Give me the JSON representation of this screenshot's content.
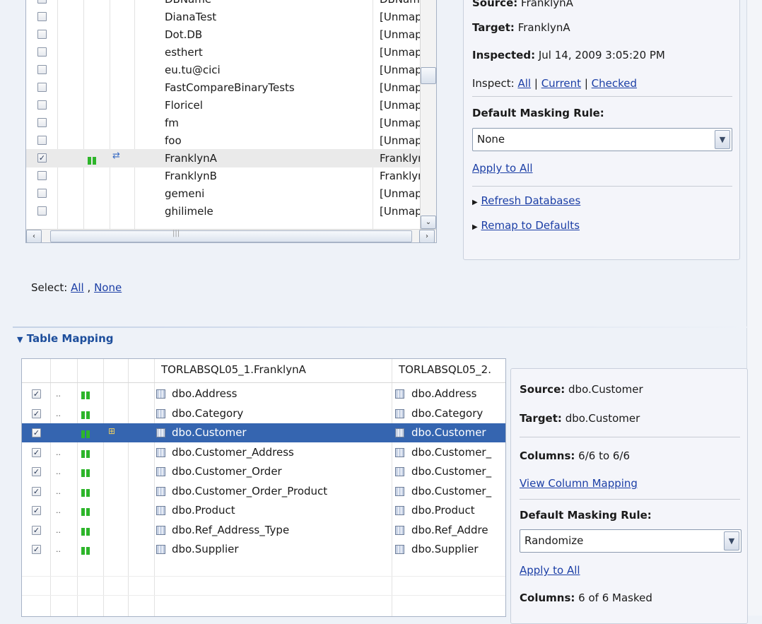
{
  "db_table": {
    "rows": [
      {
        "checked": false,
        "name": "DBName",
        "target": "DBName",
        "selected": false,
        "indicator": false
      },
      {
        "checked": false,
        "name": "DianaTest",
        "target": "[Unmappe",
        "selected": false,
        "indicator": false
      },
      {
        "checked": false,
        "name": "Dot.DB",
        "target": "[Unmappe",
        "selected": false,
        "indicator": false
      },
      {
        "checked": false,
        "name": "esthert",
        "target": "[Unmappe",
        "selected": false,
        "indicator": false
      },
      {
        "checked": false,
        "name": "eu.tu@cici",
        "target": "[Unmappe",
        "selected": false,
        "indicator": false
      },
      {
        "checked": false,
        "name": "FastCompareBinaryTests",
        "target": "[Unmappe",
        "selected": false,
        "indicator": false
      },
      {
        "checked": false,
        "name": "Floricel",
        "target": "[Unmappe",
        "selected": false,
        "indicator": false
      },
      {
        "checked": false,
        "name": "fm",
        "target": "[Unmappe",
        "selected": false,
        "indicator": false
      },
      {
        "checked": false,
        "name": "foo",
        "target": "[Unmappe",
        "selected": false,
        "indicator": false
      },
      {
        "checked": true,
        "name": "FranklynA",
        "target": "FranklynA",
        "selected": true,
        "indicator": true
      },
      {
        "checked": false,
        "name": "FranklynB",
        "target": "FranklynB",
        "selected": false,
        "indicator": false
      },
      {
        "checked": false,
        "name": "gemeni",
        "target": "[Unmappe",
        "selected": false,
        "indicator": false
      },
      {
        "checked": false,
        "name": "ghilimele",
        "target": "[Unmappe",
        "selected": false,
        "indicator": false
      }
    ]
  },
  "db_details": {
    "source_label": "Source:",
    "source_value": "FranklynA",
    "target_label": "Target:",
    "target_value": "FranklynA",
    "inspected_label": "Inspected:",
    "inspected_value": "Jul 14, 2009 3:05:20 PM",
    "inspect_label": "Inspect:",
    "inspect_all": "All",
    "inspect_current": "Current",
    "inspect_checked": "Checked",
    "separator": "|",
    "masking_label": "Default Masking Rule:",
    "masking_value": "None",
    "apply_all": "Apply to All",
    "refresh": "Refresh Databases",
    "remap": "Remap to Defaults"
  },
  "select_bar": {
    "label": "Select:",
    "all": "All",
    "comma": ",",
    "none": "None"
  },
  "table_mapping": {
    "section_title": "Table Mapping",
    "header_source": "TORLABSQL05_1.FranklynA",
    "header_target": "TORLABSQL05_2.",
    "rows": [
      {
        "checked": true,
        "source": "dbo.Address",
        "target": "dbo.Address",
        "selected": false
      },
      {
        "checked": true,
        "source": "dbo.Category",
        "target": "dbo.Category",
        "selected": false
      },
      {
        "checked": true,
        "source": "dbo.Customer",
        "target": "dbo.Customer",
        "selected": true
      },
      {
        "checked": true,
        "source": "dbo.Customer_Address",
        "target": "dbo.Customer_",
        "selected": false
      },
      {
        "checked": true,
        "source": "dbo.Customer_Order",
        "target": "dbo.Customer_",
        "selected": false
      },
      {
        "checked": true,
        "source": "dbo.Customer_Order_Product",
        "target": "dbo.Customer_",
        "selected": false
      },
      {
        "checked": true,
        "source": "dbo.Product",
        "target": "dbo.Product",
        "selected": false
      },
      {
        "checked": true,
        "source": "dbo.Ref_Address_Type",
        "target": "dbo.Ref_Addre",
        "selected": false
      },
      {
        "checked": true,
        "source": "dbo.Supplier",
        "target": "dbo.Supplier",
        "selected": false
      }
    ]
  },
  "table_details": {
    "source_label": "Source:",
    "source_value": "dbo.Customer",
    "target_label": "Target:",
    "target_value": "dbo.Customer",
    "columns_label": "Columns:",
    "columns_value": "6/6 to 6/6",
    "view_mapping": "View Column Mapping",
    "masking_label": "Default Masking Rule:",
    "masking_value": "Randomize",
    "apply_all": "Apply to All",
    "masked_label": "Columns:",
    "masked_value": "6 of 6 Masked"
  },
  "colors": {
    "selection": "#3565b0",
    "link": "#1c3fa6",
    "indicator_green": "#2db52a"
  }
}
